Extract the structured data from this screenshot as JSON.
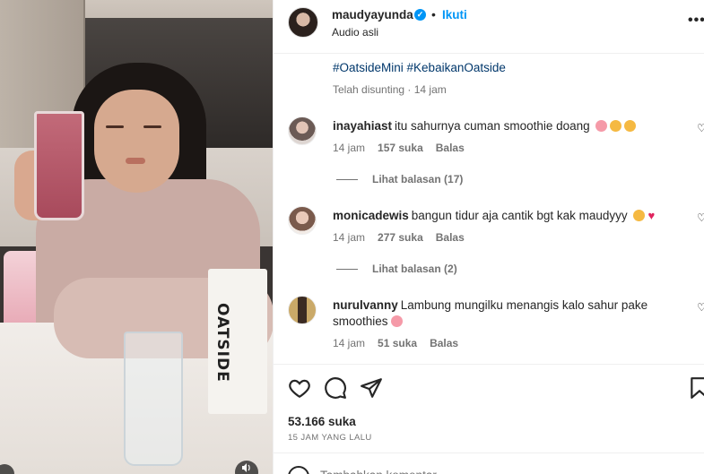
{
  "post": {
    "username": "maudyayunda",
    "verified": true,
    "follow_label": "Ikuti",
    "audio": "Audio asli",
    "more_label": "•••",
    "caption_tags": "#OatsideMini #KebaikanOatside",
    "edited": "Telah disunting · 14 jam",
    "media_brand_text": "OATSIDE"
  },
  "comments": [
    {
      "user": "inayahiast",
      "text": "itu sahurnya cuman smoothie doang",
      "emojis": [
        "#f59aa8",
        "#f5b942",
        "#f5b942"
      ],
      "time": "14 jam",
      "likes": "157 suka",
      "reply": "Balas",
      "view_replies": "Lihat balasan (17)"
    },
    {
      "user": "monicadewis",
      "text": "bangun tidur aja cantik bgt kak maudyyy",
      "emojis": [
        "#f5b942",
        "#e0245e"
      ],
      "time": "14 jam",
      "likes": "277 suka",
      "reply": "Balas",
      "view_replies": "Lihat balasan (2)"
    },
    {
      "user": "nurulvanny",
      "text": "Lambung mungilku menangis kalo sahur pake smoothies",
      "emojis": [
        "#f59aa8"
      ],
      "time": "14 jam",
      "likes": "51 suka",
      "reply": "Balas",
      "view_replies": ""
    }
  ],
  "actions": {
    "like_icon": "heart-icon",
    "comment_icon": "comment-icon",
    "share_icon": "share-icon",
    "save_icon": "bookmark-icon"
  },
  "stats": {
    "likes": "53.166 suka",
    "time_ago": "15 JAM YANG LALU"
  },
  "composer": {
    "placeholder": "Tambahkan komentar..."
  },
  "colors": {
    "link_blue": "#0095f6",
    "hashtag": "#00376b",
    "muted": "#737373"
  }
}
